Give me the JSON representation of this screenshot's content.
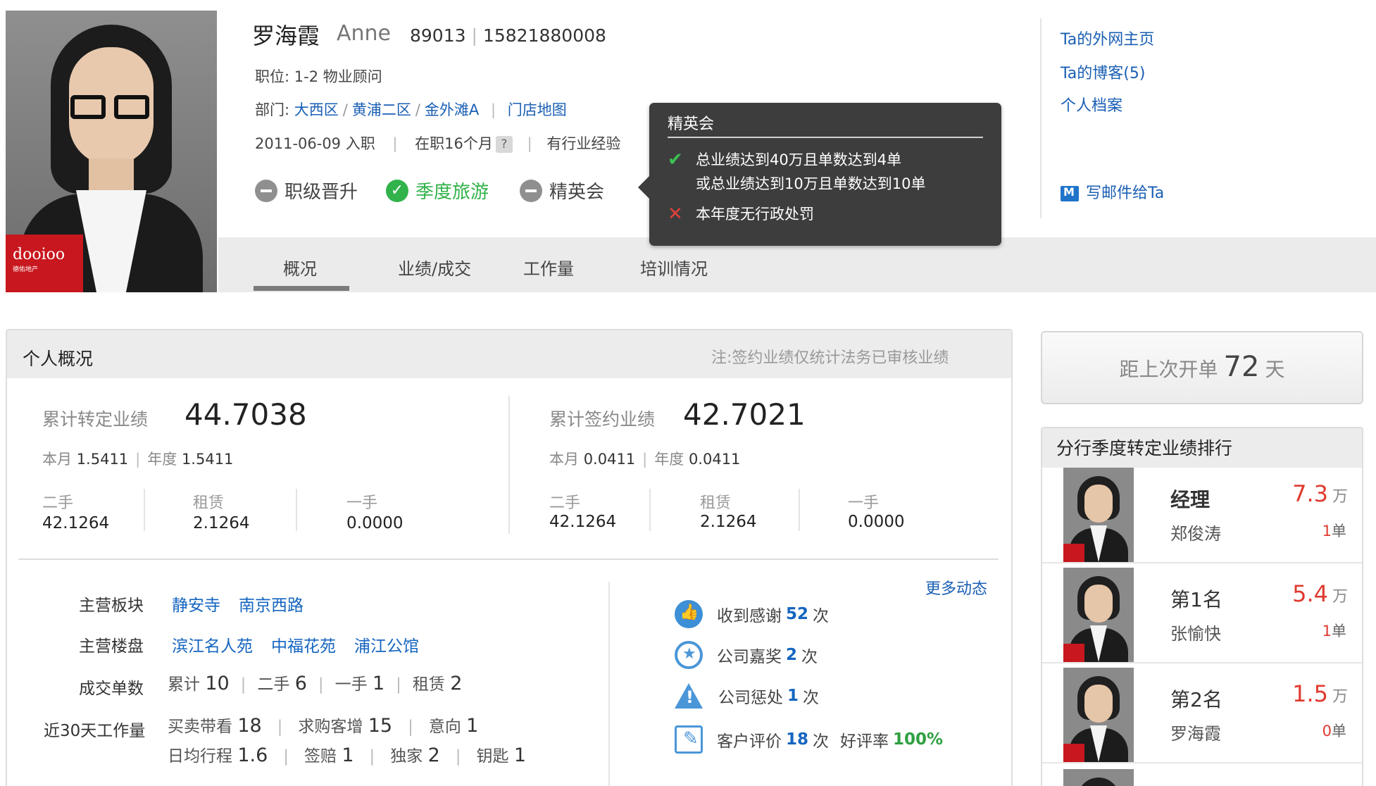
{
  "profile": {
    "name": "罗海霞",
    "english_name": "Anne",
    "employee_id": "89013",
    "phone": "15821880008",
    "position_label": "职位:",
    "position_value": "1-2 物业顾问",
    "department_label": "部门:",
    "departments": [
      "大西区",
      "黄浦二区",
      "金外滩A"
    ],
    "store_map_link": "门店地图",
    "join_date": "2011-06-09 入职",
    "tenure": "在职16个月",
    "tenure_help": "?",
    "experience": "有行业经验",
    "photo_logo": "dooioo",
    "photo_logo_sub": "德佑地产",
    "badges": [
      {
        "label": "职级晋升",
        "state": "inactive"
      },
      {
        "label": "季度旅游",
        "state": "achieved"
      },
      {
        "label": "精英会",
        "state": "inactive"
      }
    ]
  },
  "tooltip": {
    "title": "精英会",
    "conditions": [
      {
        "status": "met",
        "icon": "check-icon",
        "line1": "总业绩达到40万且单数达到4单",
        "line2": "或总业绩达到10万且单数达到10单"
      },
      {
        "status": "unmet",
        "icon": "cross-icon",
        "line1": "本年度无行政处罚",
        "line2": ""
      }
    ]
  },
  "tabs": [
    "概况",
    "业绩/成交",
    "工作量",
    "培训情况"
  ],
  "side_links": [
    "Ta的外网主页",
    "Ta的博客(5)",
    "个人档案"
  ],
  "mail_link": "写邮件给Ta",
  "overview": {
    "title": "个人概况",
    "note": "注:签约业绩仅统计法务已审核业绩",
    "transfer": {
      "label": "累计转定业绩",
      "total": "44.7038",
      "month_label": "本月",
      "month_value": "1.5411",
      "year_label": "年度",
      "year_value": "1.5411",
      "columns": [
        {
          "label": "二手",
          "value": "42.1264"
        },
        {
          "label": "租赁",
          "value": "2.1264"
        },
        {
          "label": "一手",
          "value": "0.0000"
        }
      ]
    },
    "signed": {
      "label": "累计签约业绩",
      "total": "42.7021",
      "month_label": "本月",
      "month_value": "0.0411",
      "year_label": "年度",
      "year_value": "0.0411",
      "columns": [
        {
          "label": "二手",
          "value": "42.1264"
        },
        {
          "label": "租赁",
          "value": "2.1264"
        },
        {
          "label": "一手",
          "value": "0.0000"
        }
      ]
    },
    "main_area_label": "主营板块",
    "main_areas": [
      "静安寺",
      "南京西路"
    ],
    "main_estates_label": "主营楼盘",
    "main_estates": [
      "滨江名人苑",
      "中福花苑",
      "浦江公馆"
    ],
    "deals_label": "成交单数",
    "deals": [
      {
        "label": "累计",
        "value": "10"
      },
      {
        "label": "二手",
        "value": "6"
      },
      {
        "label": "一手",
        "value": "1"
      },
      {
        "label": "租赁",
        "value": "2"
      }
    ],
    "workload_label": "近30天工作量",
    "workload_row1": [
      {
        "label": "买卖带看",
        "value": "18"
      },
      {
        "label": "求购客增",
        "value": "15"
      },
      {
        "label": "意向",
        "value": "1"
      }
    ],
    "workload_row2": [
      {
        "label": "日均行程",
        "value": "1.6"
      },
      {
        "label": "签赔",
        "value": "1"
      },
      {
        "label": "独家",
        "value": "2"
      },
      {
        "label": "钥匙",
        "value": "1"
      }
    ],
    "more_link": "更多动态",
    "activities": [
      {
        "icon": "thumbs-up-icon",
        "pre": "收到感谢",
        "count": "52",
        "post": "次"
      },
      {
        "icon": "medal-icon",
        "pre": "公司嘉奖",
        "count": "2",
        "post": "次"
      },
      {
        "icon": "warning-icon",
        "pre": "公司惩处",
        "count": "1",
        "post": "次"
      },
      {
        "icon": "edit-icon",
        "pre": "客户评价",
        "count": "18",
        "post": "次",
        "rate_label": "好评率",
        "rate": "100%"
      }
    ]
  },
  "streak": {
    "prefix": "距上次开单",
    "days": "72",
    "suffix": "天"
  },
  "ranking": {
    "title": "分行季度转定业绩排行",
    "rows": [
      {
        "place": "经理",
        "name": "郑俊涛",
        "value": "7.3",
        "unit": "万",
        "count": "1",
        "count_unit": "单"
      },
      {
        "place": "第1名",
        "name": "张愉快",
        "value": "5.4",
        "unit": "万",
        "count": "1",
        "count_unit": "单"
      },
      {
        "place": "第2名",
        "name": "罗海霞",
        "value": "1.5",
        "unit": "万",
        "count": "0",
        "count_unit": "单"
      }
    ]
  }
}
